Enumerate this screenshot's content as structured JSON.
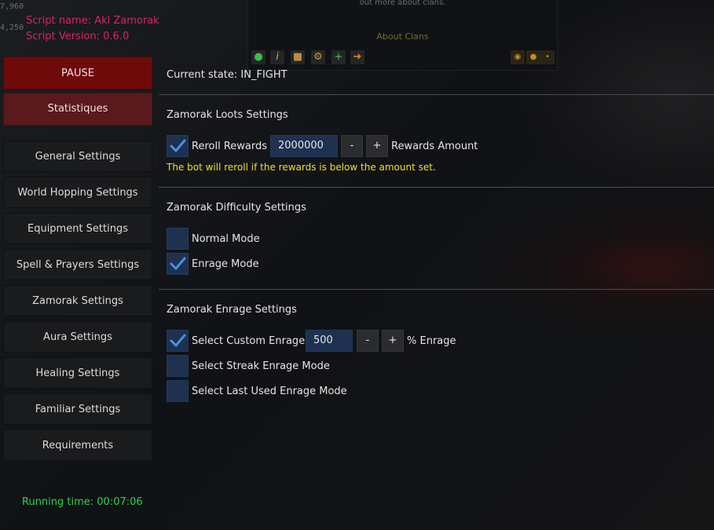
{
  "background": {
    "stats_1": "7,960",
    "stats_2": "4,250",
    "clan_text": "out more about clans.",
    "about_clans": "About Clans"
  },
  "header": {
    "script_name": "Script name: Akl Zamorak",
    "script_version": "Script Version: 0.6.0"
  },
  "sidebar": {
    "pause_label": "PAUSE",
    "stats_label": "Statistiques",
    "items": [
      {
        "label": "General Settings"
      },
      {
        "label": "World Hopping Settings"
      },
      {
        "label": "Equipment Settings"
      },
      {
        "label": "Spell & Prayers Settings"
      },
      {
        "label": "Zamorak Settings"
      },
      {
        "label": "Aura Settings"
      },
      {
        "label": "Healing Settings"
      },
      {
        "label": "Familiar Settings"
      },
      {
        "label": "Requirements"
      }
    ],
    "running_time": "Running time: 00:07:06"
  },
  "main": {
    "current_state": "Current state: IN_FIGHT",
    "loots": {
      "title": "Zamorak Loots Settings",
      "reroll_label": "Reroll Rewards",
      "reroll_checked": true,
      "amount_value": "2000000",
      "minus": "-",
      "plus": "+",
      "amount_label": "Rewards Amount",
      "hint": "The bot will reroll if the rewards is below the amount set."
    },
    "difficulty": {
      "title": "Zamorak Difficulty Settings",
      "normal_label": "Normal Mode",
      "normal_checked": false,
      "enrage_label": "Enrage Mode",
      "enrage_checked": true
    },
    "enrage": {
      "title": "Zamorak Enrage Settings",
      "custom_label": "Select Custom Enrage",
      "custom_checked": true,
      "custom_value": "500",
      "minus": "-",
      "plus": "+",
      "percent_label": "% Enrage",
      "streak_label": "Select Streak Enrage Mode",
      "streak_checked": false,
      "last_used_label": "Select Last Used Enrage Mode",
      "last_used_checked": false
    }
  },
  "colors": {
    "accent_checkbox": "#1d3150",
    "check_mark": "#4a90e2",
    "pause_bg": "#6e0a0a",
    "running_time": "#2fd14a",
    "hint": "#e8e321",
    "script_name": "#d6255f"
  }
}
